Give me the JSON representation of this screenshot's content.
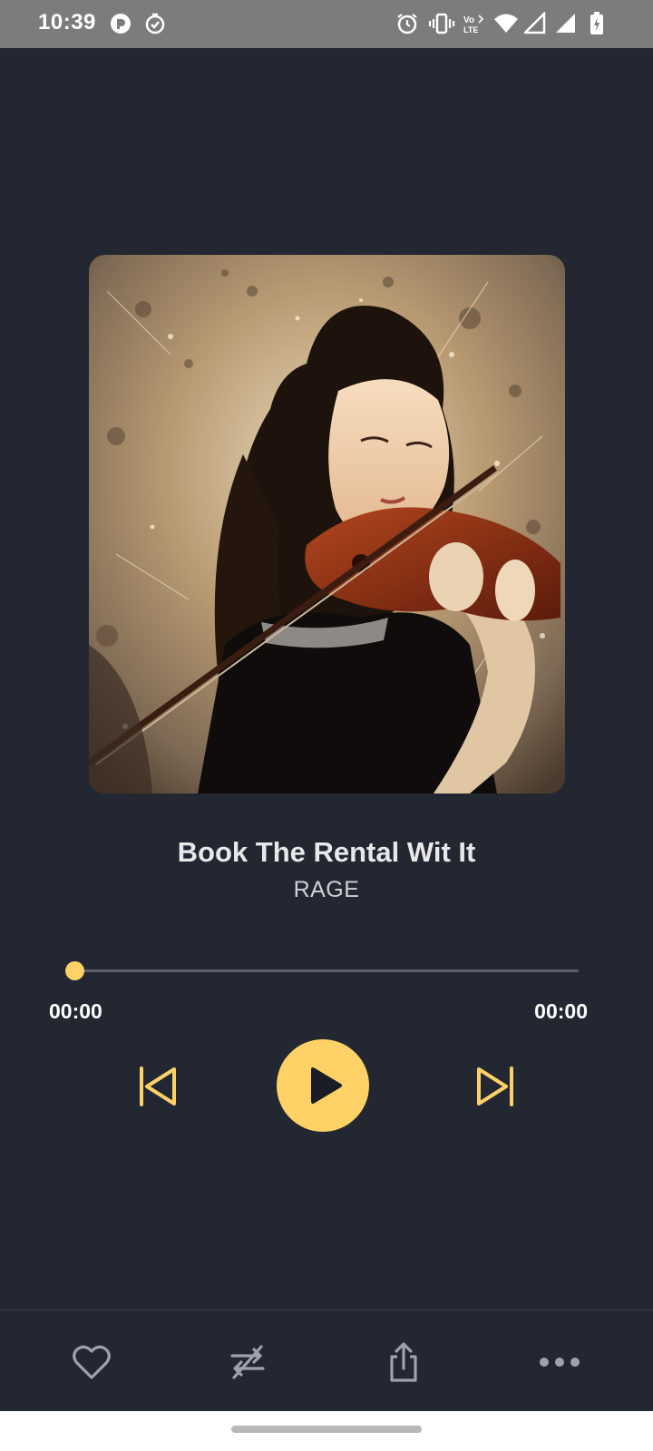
{
  "status_bar": {
    "time": "10:39",
    "left_icons": [
      "pocket-casts-icon",
      "check-timer-icon"
    ],
    "right_icons": [
      "alarm-icon",
      "vibrate-icon",
      "volte-icon",
      "wifi-icon",
      "cell-signal-icon",
      "cell-signal-icon",
      "battery-icon"
    ],
    "volte_label": "Vo LTE"
  },
  "player": {
    "album_art": "violinist-artwork-image",
    "title": "Book The Rental Wit It",
    "artist": "RAGE",
    "elapsed": "00:00",
    "duration": "00:00",
    "progress": 0.0,
    "accent_color": "#ffd166",
    "controls": {
      "previous": "skip-previous-icon",
      "play": "play-icon",
      "next": "skip-next-icon"
    }
  },
  "bottom_bar": {
    "items": [
      "heart-icon",
      "repeat-off-icon",
      "share-icon",
      "more-icon"
    ]
  },
  "colors": {
    "background": "#222732",
    "status_bar": "#7c7c7c"
  }
}
